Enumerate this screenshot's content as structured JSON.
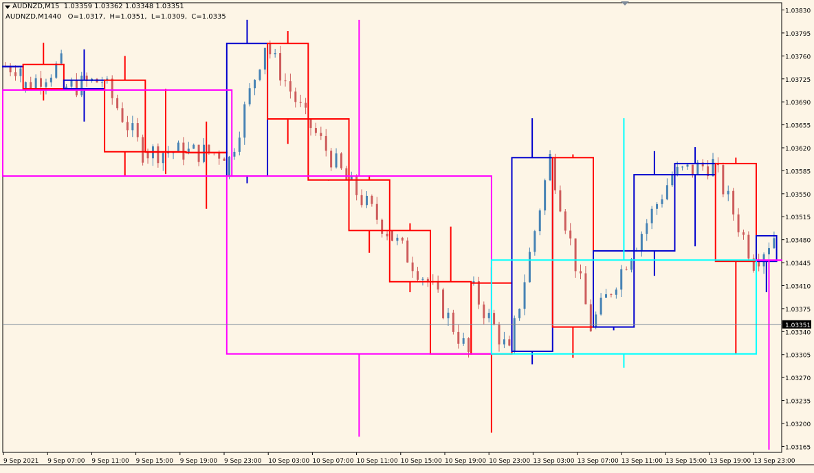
{
  "header": {
    "line1": "AUDNZD,M15  1.03359 1.03362 1.03348 1.03351",
    "line2": "AUDNZD,M1440   O=1.0317,  H=1.0351,  L=1.0309,  C=1.0335"
  },
  "colors": {
    "background": "#fdf5e6",
    "bull_candle": "#4682b4",
    "bear_candle": "#cd5c5c",
    "red_box": "#ff0000",
    "blue_box": "#0000cd",
    "magenta_box": "#ff00ff",
    "cyan_box": "#00ffff",
    "price_line": "#7d8a99",
    "price_tag_bg": "#000000",
    "price_tag_text": "#ffffff",
    "axis": "#000000"
  },
  "chart_data": {
    "type": "candlestick",
    "symbol": "AUDNZD",
    "timeframe": "M15",
    "ylim": [
      1.03156,
      1.03841
    ],
    "y_ticks": [
      "1.03830",
      "1.03795",
      "1.03760",
      "1.03725",
      "1.03690",
      "1.03655",
      "1.03620",
      "1.03585",
      "1.03550",
      "1.03515",
      "1.03480",
      "1.03445",
      "1.03410",
      "1.03375",
      "1.03340",
      "1.03305",
      "1.03270",
      "1.03235",
      "1.03200",
      "1.03165"
    ],
    "x_ticks": [
      "9 Sep 2021",
      "9 Sep 07:00",
      "9 Sep 11:00",
      "9 Sep 15:00",
      "9 Sep 19:00",
      "9 Sep 23:00",
      "10 Sep 03:00",
      "10 Sep 07:00",
      "10 Sep 11:00",
      "10 Sep 15:00",
      "10 Sep 19:00",
      "10 Sep 23:00",
      "13 Sep 03:00",
      "13 Sep 07:00",
      "13 Sep 11:00",
      "13 Sep 15:00",
      "13 Sep 19:00",
      "13 Sep 23:00"
    ],
    "current_price": "1.03351",
    "boxes": [
      {
        "color": "blue",
        "o": 1.03744,
        "c": 1.03744,
        "h": 1.03744,
        "l": 1.03744,
        "start": 0,
        "end": 3
      },
      {
        "color": "red",
        "o": 1.0371,
        "c": 1.03747,
        "h": 1.0378,
        "l": 1.03692,
        "start": 4,
        "end": 11
      },
      {
        "color": "blue",
        "o": 1.0371,
        "c": 1.03723,
        "h": 1.0377,
        "l": 1.0366,
        "start": 12,
        "end": 19
      },
      {
        "color": "red",
        "o": 1.03723,
        "c": 1.03614,
        "h": 1.0376,
        "l": 1.03578,
        "start": 20,
        "end": 27
      },
      {
        "color": "red",
        "o": 1.03614,
        "c": 1.03614,
        "h": 1.0371,
        "l": 1.0358,
        "start": 28,
        "end": 35
      },
      {
        "color": "red",
        "o": 1.03613,
        "c": 1.03613,
        "h": 1.0366,
        "l": 1.03527,
        "start": 36,
        "end": 43
      },
      {
        "color": "blue",
        "o": 1.03577,
        "c": 1.03779,
        "h": 1.03815,
        "l": 1.03566,
        "start": 44,
        "end": 51
      },
      {
        "color": "red",
        "o": 1.03779,
        "c": 1.03664,
        "h": 1.03798,
        "l": 1.03626,
        "start": 52,
        "end": 59
      },
      {
        "color": "red",
        "o": 1.03664,
        "c": 1.03571,
        "h": 1.03664,
        "l": 1.0357,
        "start": 60,
        "end": 67
      },
      {
        "color": "red",
        "o": 1.03571,
        "c": 1.03494,
        "h": 1.03578,
        "l": 1.0346,
        "start": 68,
        "end": 75
      },
      {
        "color": "red",
        "o": 1.03494,
        "c": 1.03416,
        "h": 1.03505,
        "l": 1.034,
        "start": 76,
        "end": 83
      },
      {
        "color": "red",
        "o": 1.03416,
        "c": 1.03306,
        "h": 1.035,
        "l": 1.03306,
        "start": 84,
        "end": 91
      },
      {
        "color": "red",
        "o": 1.03414,
        "c": 1.03306,
        "h": 1.03438,
        "l": 1.03186,
        "start": 92,
        "end": 99
      },
      {
        "color": "blue",
        "o": 1.0331,
        "c": 1.03605,
        "h": 1.03665,
        "l": 1.0329,
        "start": 100,
        "end": 107
      },
      {
        "color": "red",
        "o": 1.03605,
        "c": 1.03347,
        "h": 1.0361,
        "l": 1.033,
        "start": 108,
        "end": 115
      },
      {
        "color": "blue",
        "o": 1.03347,
        "c": 1.03463,
        "h": 1.03463,
        "l": 1.03342,
        "start": 116,
        "end": 123
      },
      {
        "color": "blue",
        "o": 1.03463,
        "c": 1.03579,
        "h": 1.03615,
        "l": 1.03425,
        "start": 124,
        "end": 131
      },
      {
        "color": "blue",
        "o": 1.03579,
        "c": 1.03596,
        "h": 1.03621,
        "l": 1.0347,
        "start": 132,
        "end": 139
      },
      {
        "color": "red",
        "o": 1.03596,
        "c": 1.03447,
        "h": 1.03605,
        "l": 1.03306,
        "start": 140,
        "end": 147
      },
      {
        "color": "blue",
        "o": 1.03447,
        "c": 1.03486,
        "h": 1.03486,
        "l": 1.034,
        "start": 148,
        "end": 151
      },
      {
        "color": "magenta",
        "o": 1.03708,
        "c": 1.03577,
        "h": 1.03708,
        "l": 1.03577,
        "start": 0,
        "end": 44
      },
      {
        "color": "magenta",
        "o": 1.03577,
        "c": 1.03306,
        "h": 1.03815,
        "l": 1.0318,
        "start": 44,
        "end": 95
      },
      {
        "color": "cyan",
        "o": 1.03306,
        "c": 1.03449,
        "h": 1.03665,
        "l": 1.03285,
        "start": 96,
        "end": 147
      },
      {
        "color": "magenta",
        "o": 1.03449,
        "c": 1.03449,
        "h": 1.03449,
        "l": 1.0316,
        "start": 148,
        "end": 152
      }
    ]
  }
}
